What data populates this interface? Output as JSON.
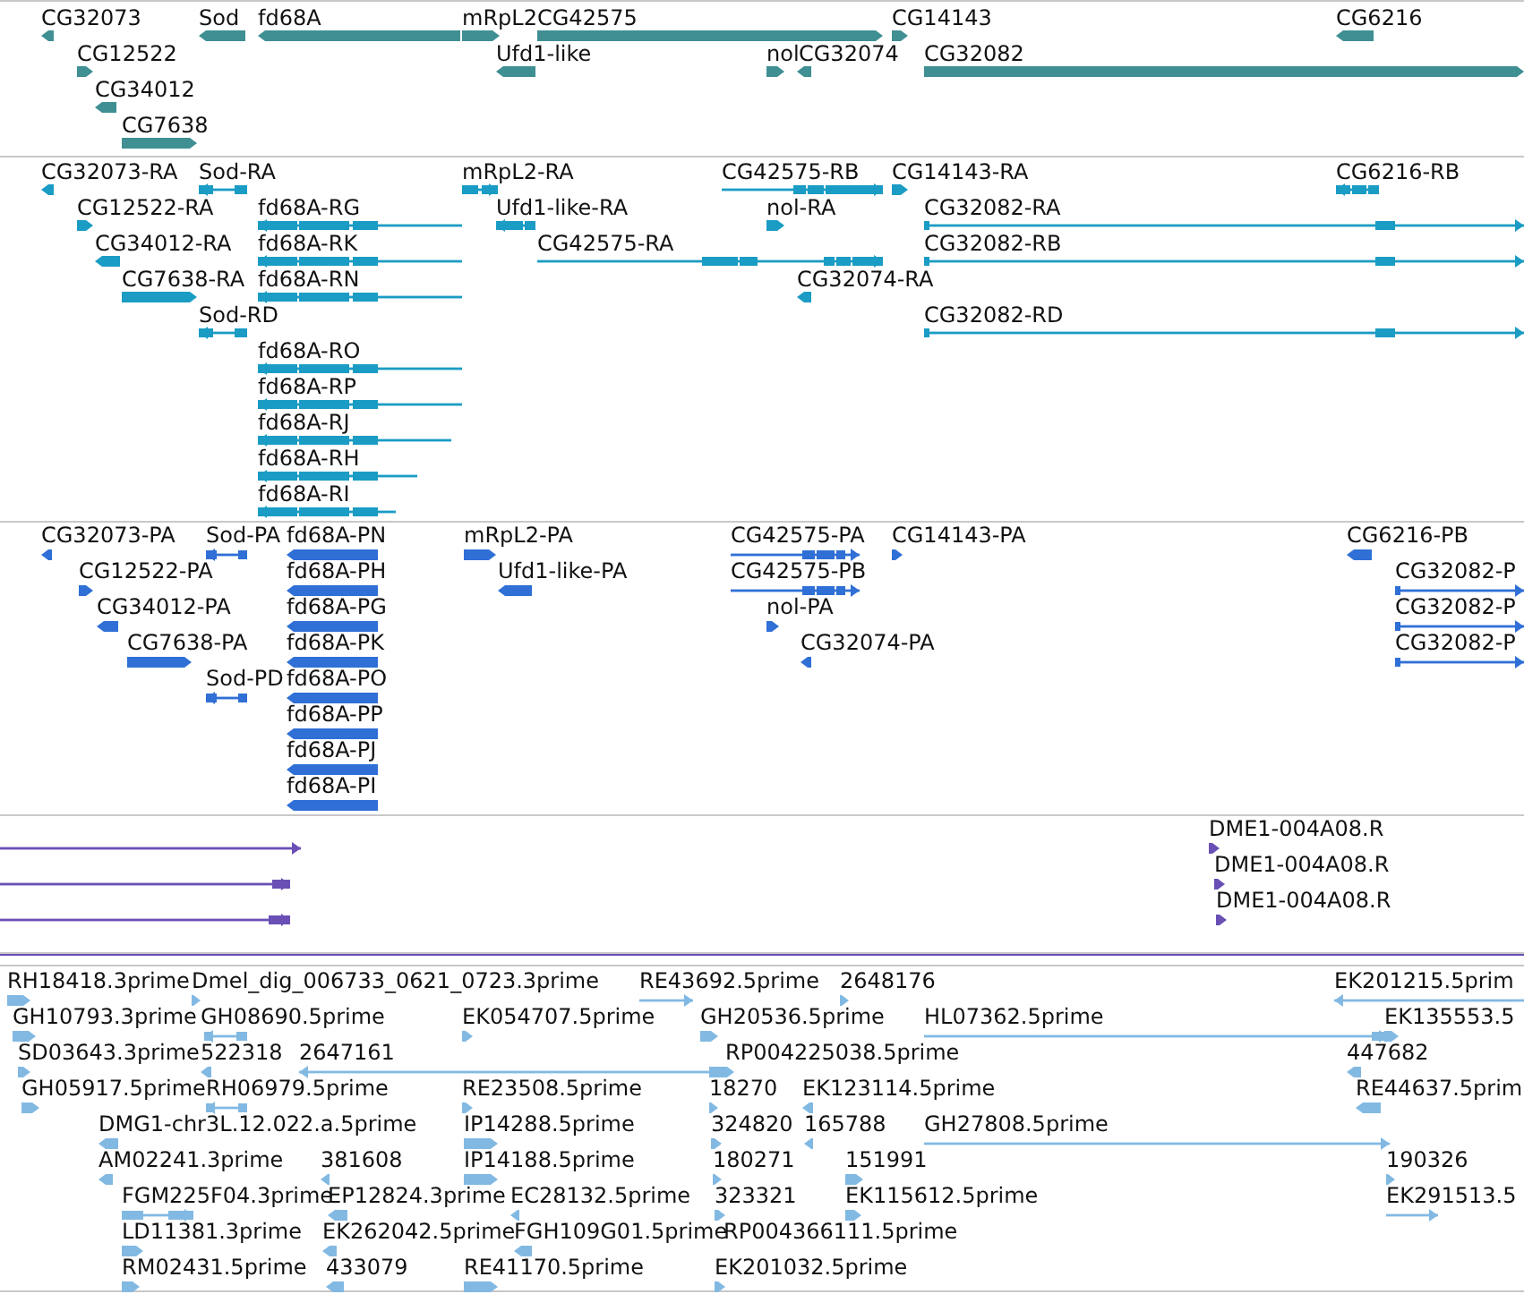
{
  "tracks": [
    {
      "color": "#3f8f93",
      "features": [
        {
          "label": "CG32073",
          "reverse": true
        },
        {
          "label": "Sod",
          "reverse": true
        },
        {
          "label": "fd68A",
          "reverse": true
        },
        {
          "label": "mRpL2",
          "reverse": false
        },
        {
          "label": "CG42575",
          "reverse": false
        },
        {
          "label": "CG14143",
          "reverse": false
        },
        {
          "label": "CG6216",
          "reverse": true
        },
        {
          "label": "CG12522",
          "reverse": false
        },
        {
          "label": "Ufd1-like",
          "reverse": true
        },
        {
          "label": "nol",
          "reverse": false
        },
        {
          "label": "CG32074",
          "reverse": true
        },
        {
          "label": "CG32082",
          "reverse": false
        },
        {
          "label": "CG34012",
          "reverse": true
        },
        {
          "label": "CG7638",
          "reverse": false
        }
      ]
    },
    {
      "color": "#1a9cc4",
      "features": [
        {
          "label": "CG32073-RA",
          "reverse": true
        },
        {
          "label": "Sod-RA",
          "reverse": true
        },
        {
          "label": "mRpL2-RA",
          "reverse": false
        },
        {
          "label": "CG42575-RB",
          "reverse": false
        },
        {
          "label": "CG14143-RA",
          "reverse": false
        },
        {
          "label": "CG6216-RB",
          "reverse": true
        },
        {
          "label": "CG12522-RA",
          "reverse": false
        },
        {
          "label": "fd68A-RG",
          "reverse": true
        },
        {
          "label": "Ufd1-like-RA",
          "reverse": true
        },
        {
          "label": "nol-RA",
          "reverse": false
        },
        {
          "label": "CG32082-RA",
          "reverse": false
        },
        {
          "label": "CG34012-RA",
          "reverse": true
        },
        {
          "label": "fd68A-RK",
          "reverse": true
        },
        {
          "label": "CG42575-RA",
          "reverse": false
        },
        {
          "label": "CG32082-RB",
          "reverse": false
        },
        {
          "label": "CG7638-RA",
          "reverse": false
        },
        {
          "label": "fd68A-RN",
          "reverse": true
        },
        {
          "label": "CG32074-RA",
          "reverse": true
        },
        {
          "label": "Sod-RD",
          "reverse": true
        },
        {
          "label": "CG32082-RD",
          "reverse": false
        },
        {
          "label": "fd68A-RO",
          "reverse": true
        },
        {
          "label": "fd68A-RP",
          "reverse": true
        },
        {
          "label": "fd68A-RJ",
          "reverse": true
        },
        {
          "label": "fd68A-RH",
          "reverse": true
        },
        {
          "label": "fd68A-RI",
          "reverse": true
        }
      ]
    },
    {
      "color": "#2f6fd6",
      "features": [
        {
          "label": "CG32073-PA",
          "reverse": true
        },
        {
          "label": "Sod-PA",
          "reverse": true
        },
        {
          "label": "fd68A-PN",
          "reverse": true
        },
        {
          "label": "mRpL2-PA",
          "reverse": false
        },
        {
          "label": "CG42575-PA",
          "reverse": false
        },
        {
          "label": "CG14143-PA",
          "reverse": false
        },
        {
          "label": "CG6216-PB",
          "reverse": true
        },
        {
          "label": "CG12522-PA",
          "reverse": false
        },
        {
          "label": "fd68A-PH",
          "reverse": true
        },
        {
          "label": "Ufd1-like-PA",
          "reverse": true
        },
        {
          "label": "CG42575-PB",
          "reverse": false
        },
        {
          "label": "CG32082-P",
          "reverse": false
        },
        {
          "label": "CG34012-PA",
          "reverse": true
        },
        {
          "label": "fd68A-PG",
          "reverse": true
        },
        {
          "label": "nol-PA",
          "reverse": false
        },
        {
          "label": "CG32082-P",
          "reverse": false
        },
        {
          "label": "CG7638-PA",
          "reverse": false
        },
        {
          "label": "fd68A-PK",
          "reverse": true
        },
        {
          "label": "CG32074-PA",
          "reverse": true
        },
        {
          "label": "CG32082-P",
          "reverse": false
        },
        {
          "label": "Sod-PD",
          "reverse": true
        },
        {
          "label": "fd68A-PO",
          "reverse": true
        },
        {
          "label": "fd68A-PP",
          "reverse": true
        },
        {
          "label": "fd68A-PJ",
          "reverse": true
        },
        {
          "label": "fd68A-PI",
          "reverse": true
        }
      ]
    },
    {
      "color": "#6a4fb5",
      "features": [
        {
          "reverse": false
        },
        {
          "label": "DME1-004A08.R",
          "reverse": false
        },
        {
          "reverse": false
        },
        {
          "label": "DME1-004A08.R",
          "reverse": false
        },
        {
          "reverse": false
        },
        {
          "label": "DME1-004A08.R",
          "reverse": false
        }
      ]
    },
    {
      "color": "#82b9e3",
      "features": [
        {
          "label": "RH18418.3prime",
          "reverse": false
        },
        {
          "label": "Dmel_dig_006733_0621_0723.3prime",
          "reverse": false
        },
        {
          "label": "RE43692.5prime",
          "reverse": false
        },
        {
          "label": "2648176",
          "reverse": false
        },
        {
          "label": "EK201215.5prim",
          "reverse": true
        },
        {
          "label": "GH10793.3prime",
          "reverse": false
        },
        {
          "label": "GH08690.5prime",
          "reverse": true
        },
        {
          "label": "EK054707.5prime",
          "reverse": false
        },
        {
          "label": "GH20536.5prime",
          "reverse": false
        },
        {
          "label": "HL07362.5prime",
          "reverse": false
        },
        {
          "label": "EK135553.5",
          "reverse": false
        },
        {
          "label": "SD03643.3prime",
          "reverse": false
        },
        {
          "label": "522318",
          "reverse": true
        },
        {
          "label": "2647161",
          "reverse": true
        },
        {
          "label": "RP004225038.5prime",
          "reverse": false
        },
        {
          "label": "447682",
          "reverse": true
        },
        {
          "label": "GH05917.5prime",
          "reverse": false
        },
        {
          "label": "RH06979.5prime",
          "reverse": true
        },
        {
          "label": "RE23508.5prime",
          "reverse": false
        },
        {
          "label": "18270",
          "reverse": false
        },
        {
          "label": "EK123114.5prime",
          "reverse": true
        },
        {
          "label": "RE44637.5prim",
          "reverse": true
        },
        {
          "label": "DMG1-chr3L.12.022.a.5prime",
          "reverse": true
        },
        {
          "label": "IP14288.5prime",
          "reverse": false
        },
        {
          "label": "324820",
          "reverse": false
        },
        {
          "label": "165788",
          "reverse": true
        },
        {
          "label": "GH27808.5prime",
          "reverse": false
        },
        {
          "label": "AM02241.3prime",
          "reverse": true
        },
        {
          "label": "381608",
          "reverse": true
        },
        {
          "label": "IP14188.5prime",
          "reverse": false
        },
        {
          "label": "180271",
          "reverse": false
        },
        {
          "label": "151991",
          "reverse": false
        },
        {
          "label": "190326",
          "reverse": false
        },
        {
          "label": "FGM225F04.3prime",
          "reverse": false
        },
        {
          "label": "EP12824.3prime",
          "reverse": true
        },
        {
          "label": "EC28132.5prime",
          "reverse": true
        },
        {
          "label": "323321",
          "reverse": false
        },
        {
          "label": "EK115612.5prime",
          "reverse": false
        },
        {
          "label": "EK291513.5",
          "reverse": false
        },
        {
          "label": "LD11381.3prime",
          "reverse": false
        },
        {
          "label": "EK262042.5prime",
          "reverse": true
        },
        {
          "label": "FGH109G01.5prime",
          "reverse": true
        },
        {
          "label": "RP004366111.5prime"
        },
        {
          "label": "RM02431.5prime",
          "reverse": false
        },
        {
          "label": "433079",
          "reverse": true
        },
        {
          "label": "RE41170.5prime",
          "reverse": false
        },
        {
          "label": "EK201032.5prime",
          "reverse": false
        }
      ]
    }
  ]
}
